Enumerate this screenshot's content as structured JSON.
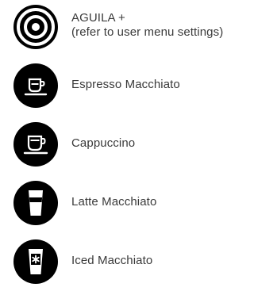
{
  "menu": {
    "items": [
      {
        "key": "aguila-plus",
        "icon": "aguila-target-icon",
        "label_line1": "AGUILA +",
        "label_line2": "(refer to user menu settings)"
      },
      {
        "key": "espresso-macchiato",
        "icon": "espresso-macchiato-cup-icon",
        "label": "Espresso Macchiato"
      },
      {
        "key": "cappuccino",
        "icon": "cappuccino-cup-icon",
        "label": "Cappuccino"
      },
      {
        "key": "latte-macchiato",
        "icon": "latte-macchiato-glass-icon",
        "label": "Latte Macchiato"
      },
      {
        "key": "iced-macchiato",
        "icon": "iced-macchiato-glass-icon",
        "label": "Iced Macchiato"
      }
    ]
  },
  "colors": {
    "icon_fill": "#000000",
    "icon_line": "#ffffff",
    "text": "#3a3a3a"
  }
}
